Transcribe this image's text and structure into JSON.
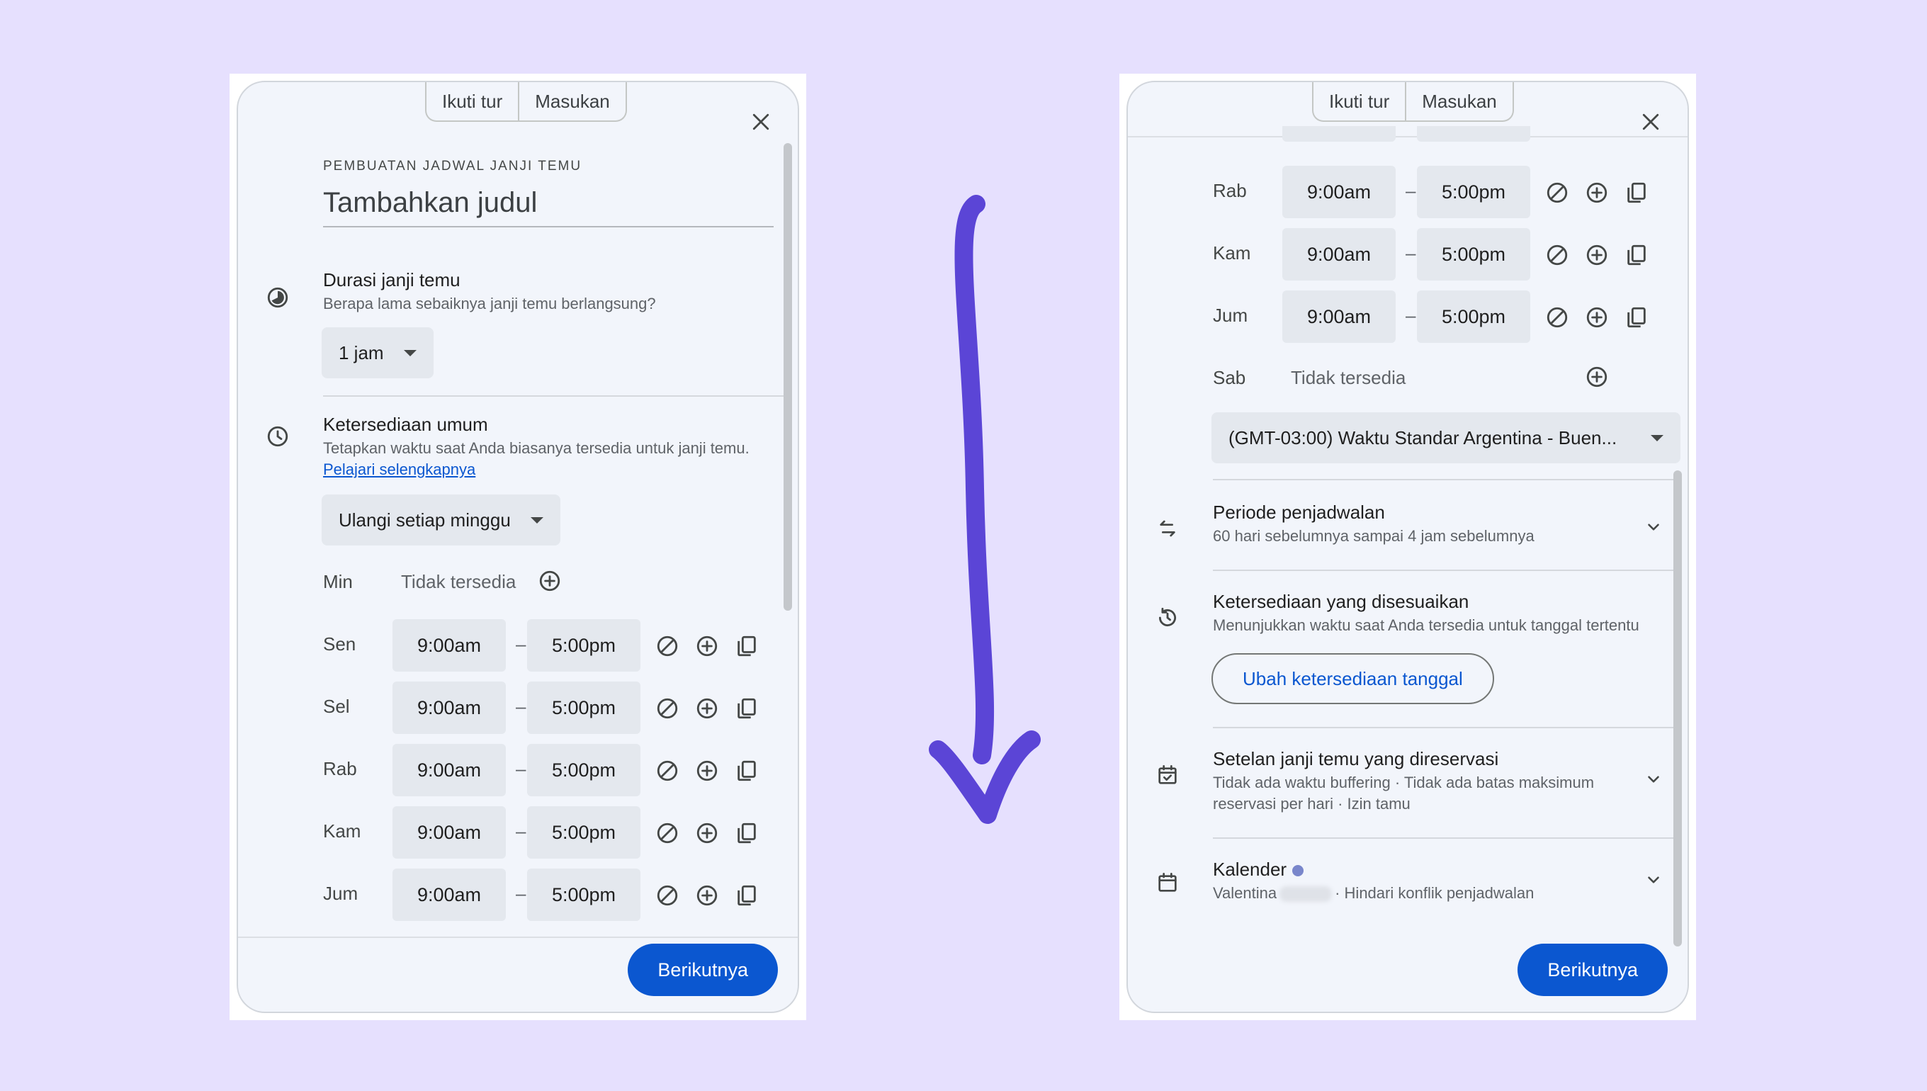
{
  "tabs": {
    "tour": "Ikuti tur",
    "feedback": "Masukan"
  },
  "colors": {
    "page_bg": "#e6e0fe",
    "panel_bg": "#f2f5fb",
    "primary": "#0b57d0",
    "arrow": "#5b45d6",
    "calendar_dot": "#7986cb"
  },
  "left": {
    "header_label": "PEMBUATAN JADWAL JANJI TEMU",
    "title_placeholder": "Tambahkan judul",
    "duration": {
      "title": "Durasi janji temu",
      "subtitle": "Berapa lama sebaiknya janji temu berlangsung?",
      "value": "1 jam",
      "icon": "timelapse-icon"
    },
    "availability": {
      "title": "Ketersediaan umum",
      "subtitle": "Tetapkan waktu saat Anda biasanya tersedia untuk janji temu.",
      "link": "Pelajari selengkapnya",
      "repeat": "Ulangi setiap minggu",
      "icon": "clock-icon",
      "unavailable_day": "Min",
      "unavailable_text": "Tidak tersedia",
      "days": [
        {
          "day": "Sen",
          "start": "9:00am",
          "end": "5:00pm"
        },
        {
          "day": "Sel",
          "start": "9:00am",
          "end": "5:00pm"
        },
        {
          "day": "Rab",
          "start": "9:00am",
          "end": "5:00pm"
        },
        {
          "day": "Kam",
          "start": "9:00am",
          "end": "5:00pm"
        },
        {
          "day": "Jum",
          "start": "9:00am",
          "end": "5:00pm"
        }
      ]
    },
    "next_button": "Berikutnya"
  },
  "right": {
    "days": [
      {
        "day": "Rab",
        "start": "9:00am",
        "end": "5:00pm"
      },
      {
        "day": "Kam",
        "start": "9:00am",
        "end": "5:00pm"
      },
      {
        "day": "Jum",
        "start": "9:00am",
        "end": "5:00pm"
      }
    ],
    "unavailable_day": "Sab",
    "unavailable_text": "Tidak tersedia",
    "timezone": "(GMT-03:00) Waktu Standar Argentina - Buen...",
    "scheduling_window": {
      "title": "Periode penjadwalan",
      "subtitle": "60 hari sebelumnya sampai 4 jam sebelumnya",
      "icon": "swap-arrows-icon"
    },
    "custom_availability": {
      "title": "Ketersediaan yang disesuaikan",
      "subtitle": "Menunjukkan waktu saat Anda tersedia untuk tanggal tertentu",
      "button": "Ubah ketersediaan tanggal",
      "icon": "history-icon"
    },
    "booked_settings": {
      "title": "Setelan janji temu yang direservasi",
      "subtitle_line1": "Tidak ada waktu buffering · Tidak ada batas maksimum",
      "subtitle_line2": "reservasi per hari · Izin tamu",
      "icon": "event-available-icon"
    },
    "calendar": {
      "title": "Kalender",
      "name": "Valentina",
      "suffix": "· Hindari konflik penjadwalan",
      "icon": "calendar-icon"
    },
    "next_button": "Berikutnya"
  }
}
